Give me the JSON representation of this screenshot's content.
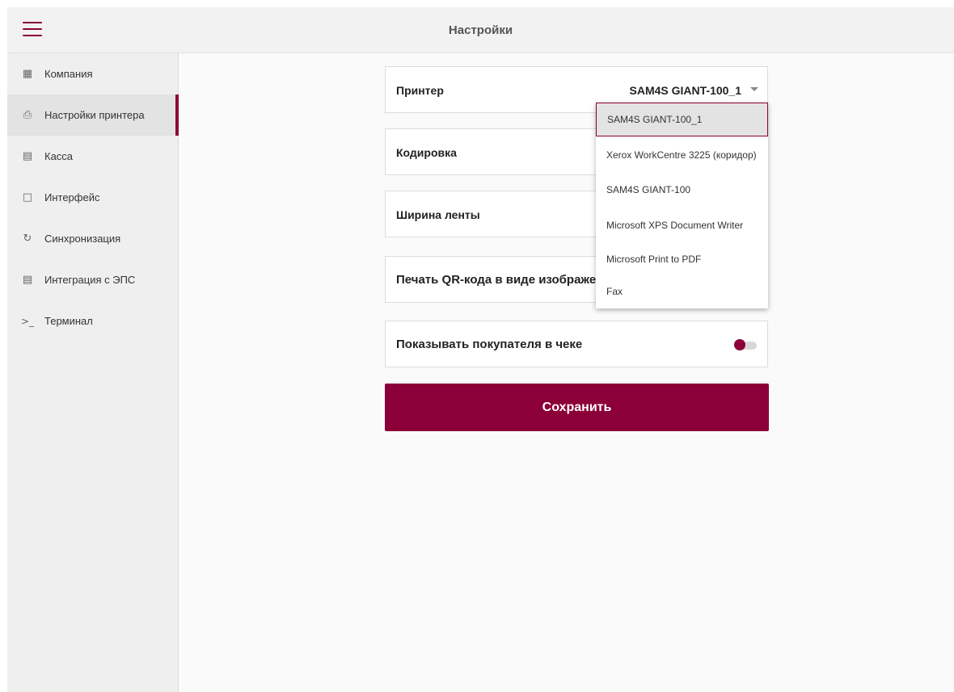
{
  "header": {
    "title": "Настройки"
  },
  "sidebar": {
    "items": [
      {
        "label": "Компания",
        "icon": "building-icon"
      },
      {
        "label": "Настройки принтера",
        "icon": "printer-icon",
        "active": true
      },
      {
        "label": "Касса",
        "icon": "cash-register-icon"
      },
      {
        "label": "Интерфейс",
        "icon": "monitor-icon"
      },
      {
        "label": "Синхронизация",
        "icon": "sync-icon"
      },
      {
        "label": "Интеграция с ЭПС",
        "icon": "card-icon"
      },
      {
        "label": "Терминал",
        "icon": "terminal-icon"
      }
    ]
  },
  "settings": {
    "printer": {
      "label": "Принтер",
      "value": "SAM4S GIANT-100_1"
    },
    "encoding": {
      "label": "Кодировка"
    },
    "tape_width": {
      "label": "Ширина ленты"
    },
    "qr_print": {
      "label": "Печать QR-кода в виде изображения"
    },
    "show_buyer": {
      "label": "Показывать покупателя в чеке",
      "enabled": true
    }
  },
  "dropdown": {
    "options": [
      "SAM4S GIANT-100_1",
      "Xerox WorkCentre 3225 (коридор)",
      "SAM4S GIANT-100",
      "Microsoft XPS Document Writer",
      "Microsoft Print to PDF",
      "Fax"
    ],
    "selected": "SAM4S GIANT-100_1"
  },
  "actions": {
    "save_label": "Сохранить"
  },
  "colors": {
    "accent": "#8b0038",
    "sidebar_bg": "#efefef",
    "header_bg": "#f2f2f2"
  }
}
